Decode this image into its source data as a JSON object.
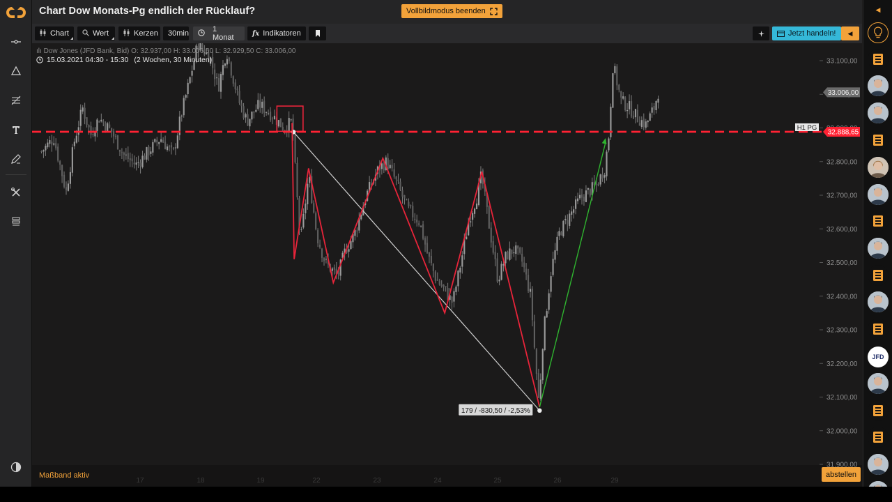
{
  "header": {
    "title": "Chart Dow Monats-Pg endlich der Rücklauf?",
    "fullscreen_label": "Vollbildmodus beenden"
  },
  "toolbar": {
    "chart_label": "Chart",
    "value_label": "Wert",
    "candles_label": "Kerzen",
    "interval_label": "30min",
    "range_label": "1 Monat",
    "indicators_label": "Indikatoren",
    "trade_label": "Jetzt handeln!"
  },
  "chart_info": {
    "instrument": "Dow Jones (JFD Bank, Bid)",
    "open": "O: 32.937,00",
    "high": "H: 33.006,50",
    "low": "L: 32.929,50",
    "close": "C: 33.006,00",
    "time_range": "15.03.2021 04:30 - 15:30",
    "time_span": "(2 Wochen, 30 Minuten)"
  },
  "status": {
    "measure_active": "Maßband aktiv",
    "abstellen_label": "abstellen"
  },
  "chart_data": {
    "type": "candlestick",
    "instrument": "Dow Jones (JFD Bank, Bid)",
    "interval": "30min",
    "y_ticks": [
      31900,
      32000,
      32100,
      32200,
      32300,
      32400,
      32500,
      32600,
      32700,
      32800,
      32900,
      33000,
      33100
    ],
    "y_tick_labels": [
      "31.900,00",
      "32.000,00",
      "32.100,00",
      "32.200,00",
      "32.300,00",
      "32.400,00",
      "32.500,00",
      "32.600,00",
      "32.700,00",
      "32.800,00",
      "32.900,00",
      "33.000,00",
      "33.100,00"
    ],
    "ylim": [
      31890,
      33150
    ],
    "x_tick_labels": [
      "17",
      "18",
      "19",
      "22",
      "23",
      "24",
      "25",
      "26",
      "29"
    ],
    "price_path": [
      {
        "t": 0,
        "p": 32830
      },
      {
        "t": 3,
        "p": 32870
      },
      {
        "t": 6,
        "p": 32710
      },
      {
        "t": 8,
        "p": 32860
      },
      {
        "t": 10,
        "p": 32960
      },
      {
        "t": 12,
        "p": 32880
      },
      {
        "t": 14,
        "p": 32930
      },
      {
        "t": 17,
        "p": 32890
      },
      {
        "t": 20,
        "p": 32820
      },
      {
        "t": 23,
        "p": 32790
      },
      {
        "t": 26,
        "p": 32830
      },
      {
        "t": 29,
        "p": 32870
      },
      {
        "t": 32,
        "p": 32820
      },
      {
        "t": 34,
        "p": 32940
      },
      {
        "t": 36,
        "p": 33040
      },
      {
        "t": 38,
        "p": 33150
      },
      {
        "t": 41,
        "p": 33110
      },
      {
        "t": 43,
        "p": 33020
      },
      {
        "t": 45,
        "p": 33130
      },
      {
        "t": 48,
        "p": 32980
      },
      {
        "t": 50,
        "p": 32920
      },
      {
        "t": 53,
        "p": 32970
      },
      {
        "t": 56,
        "p": 32940
      },
      {
        "t": 59,
        "p": 32900
      },
      {
        "t": 61,
        "p": 32920
      },
      {
        "t": 62,
        "p": 32720
      },
      {
        "t": 63,
        "p": 32560
      },
      {
        "t": 65,
        "p": 32760
      },
      {
        "t": 67,
        "p": 32580
      },
      {
        "t": 69,
        "p": 32500
      },
      {
        "t": 72,
        "p": 32460
      },
      {
        "t": 74,
        "p": 32540
      },
      {
        "t": 76,
        "p": 32580
      },
      {
        "t": 79,
        "p": 32700
      },
      {
        "t": 82,
        "p": 32780
      },
      {
        "t": 84,
        "p": 32800
      },
      {
        "t": 87,
        "p": 32720
      },
      {
        "t": 89,
        "p": 32660
      },
      {
        "t": 92,
        "p": 32620
      },
      {
        "t": 94,
        "p": 32520
      },
      {
        "t": 96,
        "p": 32450
      },
      {
        "t": 98,
        "p": 32420
      },
      {
        "t": 100,
        "p": 32380
      },
      {
        "t": 102,
        "p": 32500
      },
      {
        "t": 104,
        "p": 32630
      },
      {
        "t": 106,
        "p": 32700
      },
      {
        "t": 107,
        "p": 32760
      },
      {
        "t": 109,
        "p": 32600
      },
      {
        "t": 111,
        "p": 32450
      },
      {
        "t": 113,
        "p": 32520
      },
      {
        "t": 115,
        "p": 32540
      },
      {
        "t": 117,
        "p": 32500
      },
      {
        "t": 119,
        "p": 32400
      },
      {
        "t": 120,
        "p": 32230
      },
      {
        "t": 121,
        "p": 32080
      },
      {
        "t": 122,
        "p": 32280
      },
      {
        "t": 124,
        "p": 32480
      },
      {
        "t": 126,
        "p": 32590
      },
      {
        "t": 129,
        "p": 32650
      },
      {
        "t": 131,
        "p": 32690
      },
      {
        "t": 133,
        "p": 32710
      },
      {
        "t": 135,
        "p": 32730
      },
      {
        "t": 137,
        "p": 32780
      },
      {
        "t": 138,
        "p": 32880
      },
      {
        "t": 139,
        "p": 33090
      },
      {
        "t": 141,
        "p": 32980
      },
      {
        "t": 143,
        "p": 32960
      },
      {
        "t": 145,
        "p": 32930
      },
      {
        "t": 147,
        "p": 32910
      },
      {
        "t": 149,
        "p": 32960
      },
      {
        "t": 150,
        "p": 33006
      }
    ],
    "horizontal_line": {
      "label": "H1 PG",
      "value": 32888.65,
      "value_label": "32.888,65",
      "color": "#ff2233"
    },
    "last_price": {
      "value": 33006,
      "label": "33.006,00"
    },
    "zigzag": [
      {
        "t": 61,
        "p": 32915
      },
      {
        "t": 61.5,
        "p": 32510
      },
      {
        "t": 65,
        "p": 32780
      },
      {
        "t": 71,
        "p": 32440
      },
      {
        "t": 83,
        "p": 32810
      },
      {
        "t": 98,
        "p": 32350
      },
      {
        "t": 107,
        "p": 32770
      },
      {
        "t": 121,
        "p": 32070
      }
    ],
    "green_arrow": {
      "from": {
        "t": 121,
        "p": 32070
      },
      "to": {
        "t": 137,
        "p": 32870
      }
    },
    "measure": {
      "from": {
        "t": 61,
        "p": 32888
      },
      "to": {
        "t": 121,
        "p": 32060
      },
      "label": "179 / -830,50 / -2,53%"
    },
    "highlight_box": {
      "t0": 58,
      "t1": 64,
      "p0": 32890,
      "p1": 32965
    },
    "colors": {
      "background": "#1b1a1a",
      "candles": "#8e8e8e",
      "zigzag": "#e8243a",
      "arrow": "#2fb52f",
      "measure": "#d0d0d0"
    }
  },
  "right_rail": {
    "jfd_label": "JFD"
  }
}
